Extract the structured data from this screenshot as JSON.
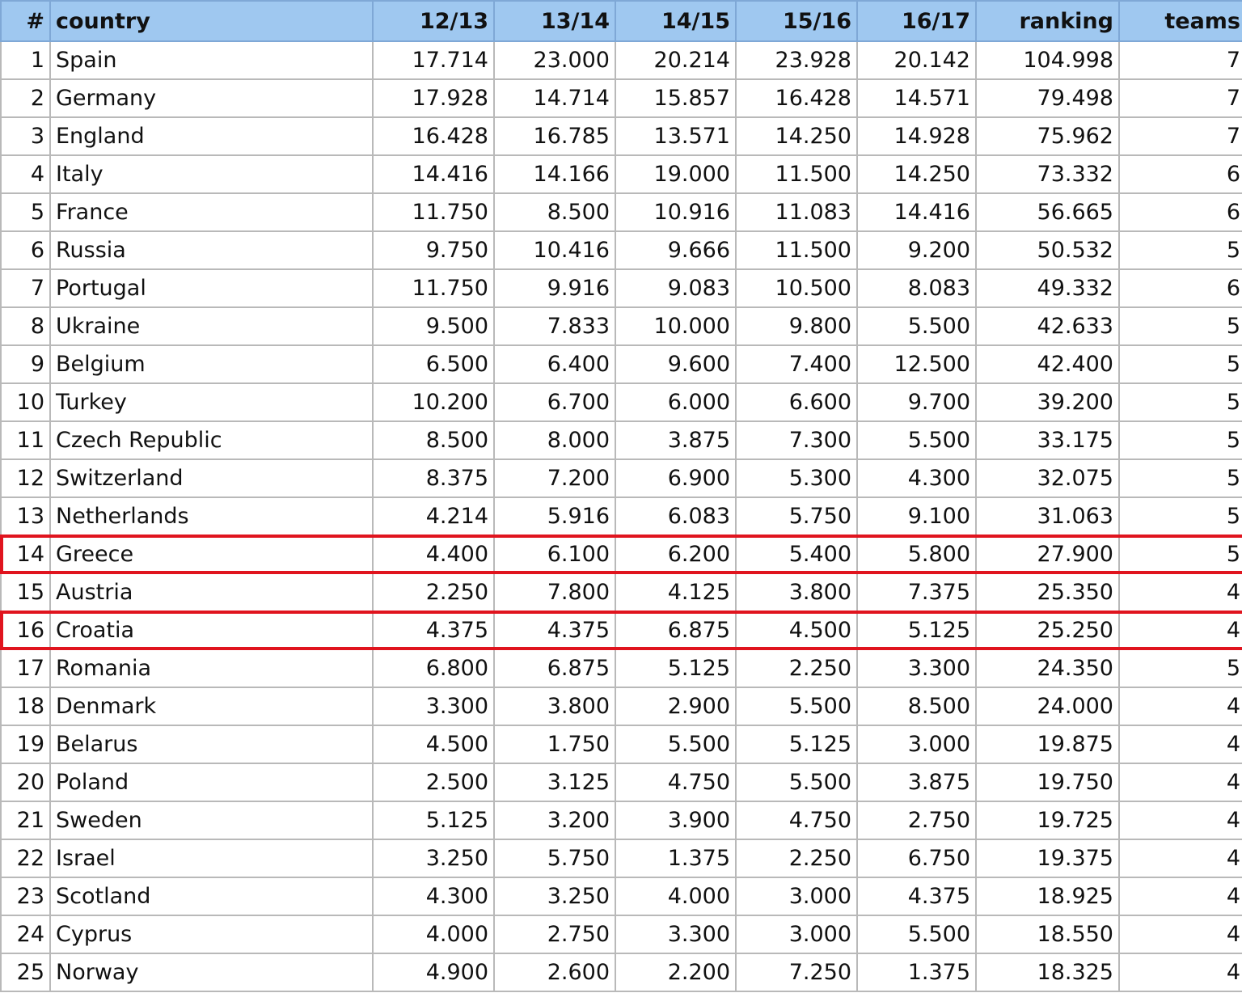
{
  "headers": [
    "#",
    "country",
    "12/13",
    "13/14",
    "14/15",
    "15/16",
    "16/17",
    "ranking",
    "teams"
  ],
  "rows": [
    [
      "1",
      "Spain",
      "17.714",
      "23.000",
      "20.214",
      "23.928",
      "20.142",
      "104.998",
      "7"
    ],
    [
      "2",
      "Germany",
      "17.928",
      "14.714",
      "15.857",
      "16.428",
      "14.571",
      "79.498",
      "7"
    ],
    [
      "3",
      "England",
      "16.428",
      "16.785",
      "13.571",
      "14.250",
      "14.928",
      "75.962",
      "7"
    ],
    [
      "4",
      "Italy",
      "14.416",
      "14.166",
      "19.000",
      "11.500",
      "14.250",
      "73.332",
      "6"
    ],
    [
      "5",
      "France",
      "11.750",
      "8.500",
      "10.916",
      "11.083",
      "14.416",
      "56.665",
      "6"
    ],
    [
      "6",
      "Russia",
      "9.750",
      "10.416",
      "9.666",
      "11.500",
      "9.200",
      "50.532",
      "5"
    ],
    [
      "7",
      "Portugal",
      "11.750",
      "9.916",
      "9.083",
      "10.500",
      "8.083",
      "49.332",
      "6"
    ],
    [
      "8",
      "Ukraine",
      "9.500",
      "7.833",
      "10.000",
      "9.800",
      "5.500",
      "42.633",
      "5"
    ],
    [
      "9",
      "Belgium",
      "6.500",
      "6.400",
      "9.600",
      "7.400",
      "12.500",
      "42.400",
      "5"
    ],
    [
      "10",
      "Turkey",
      "10.200",
      "6.700",
      "6.000",
      "6.600",
      "9.700",
      "39.200",
      "5"
    ],
    [
      "11",
      "Czech Republic",
      "8.500",
      "8.000",
      "3.875",
      "7.300",
      "5.500",
      "33.175",
      "5"
    ],
    [
      "12",
      "Switzerland",
      "8.375",
      "7.200",
      "6.900",
      "5.300",
      "4.300",
      "32.075",
      "5"
    ],
    [
      "13",
      "Netherlands",
      "4.214",
      "5.916",
      "6.083",
      "5.750",
      "9.100",
      "31.063",
      "5"
    ],
    [
      "14",
      "Greece",
      "4.400",
      "6.100",
      "6.200",
      "5.400",
      "5.800",
      "27.900",
      "5"
    ],
    [
      "15",
      "Austria",
      "2.250",
      "7.800",
      "4.125",
      "3.800",
      "7.375",
      "25.350",
      "4"
    ],
    [
      "16",
      "Croatia",
      "4.375",
      "4.375",
      "6.875",
      "4.500",
      "5.125",
      "25.250",
      "4"
    ],
    [
      "17",
      "Romania",
      "6.800",
      "6.875",
      "5.125",
      "2.250",
      "3.300",
      "24.350",
      "5"
    ],
    [
      "18",
      "Denmark",
      "3.300",
      "3.800",
      "2.900",
      "5.500",
      "8.500",
      "24.000",
      "4"
    ],
    [
      "19",
      "Belarus",
      "4.500",
      "1.750",
      "5.500",
      "5.125",
      "3.000",
      "19.875",
      "4"
    ],
    [
      "20",
      "Poland",
      "2.500",
      "3.125",
      "4.750",
      "5.500",
      "3.875",
      "19.750",
      "4"
    ],
    [
      "21",
      "Sweden",
      "5.125",
      "3.200",
      "3.900",
      "4.750",
      "2.750",
      "19.725",
      "4"
    ],
    [
      "22",
      "Israel",
      "3.250",
      "5.750",
      "1.375",
      "2.250",
      "6.750",
      "19.375",
      "4"
    ],
    [
      "23",
      "Scotland",
      "4.300",
      "3.250",
      "4.000",
      "3.000",
      "4.375",
      "18.925",
      "4"
    ],
    [
      "24",
      "Cyprus",
      "4.000",
      "2.750",
      "3.300",
      "3.000",
      "5.500",
      "18.550",
      "4"
    ],
    [
      "25",
      "Norway",
      "4.900",
      "2.600",
      "2.200",
      "7.250",
      "1.375",
      "18.325",
      "4"
    ]
  ],
  "highlighted_rows": [
    "Greece",
    "Croatia"
  ],
  "colors": {
    "header_bg": "#9fc8f0",
    "grid": "#b9b9b9",
    "highlight": "#e0141e"
  }
}
